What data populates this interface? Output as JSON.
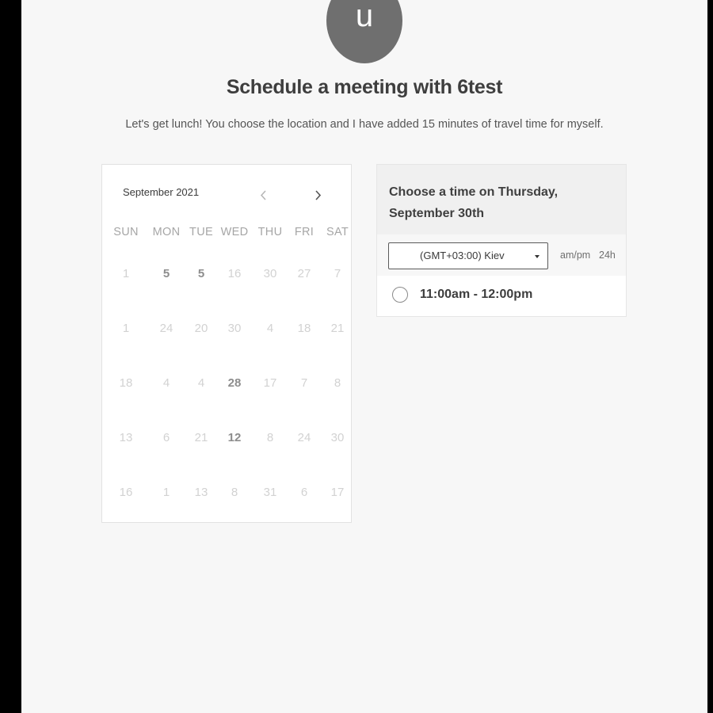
{
  "avatar": {
    "initial": "u"
  },
  "header": {
    "title": "Schedule a meeting with 6test",
    "subtitle": "Let's get lunch! You choose the location and I have added 15 minutes of travel time for myself."
  },
  "calendar": {
    "month_label": "September 2021",
    "prev_icon": "chevron-left-icon",
    "next_icon": "chevron-right-icon",
    "weekdays": [
      "SUN",
      "MON",
      "TUE",
      "WED",
      "THU",
      "FRI",
      "SAT"
    ],
    "weeks": [
      [
        {
          "d": "1",
          "available": false
        },
        {
          "d": "5",
          "available": true
        },
        {
          "d": "5",
          "available": true
        },
        {
          "d": "16",
          "available": false
        },
        {
          "d": "30",
          "available": false
        },
        {
          "d": "27",
          "available": false
        },
        {
          "d": "7",
          "available": false
        }
      ],
      [
        {
          "d": "1",
          "available": false
        },
        {
          "d": "24",
          "available": false
        },
        {
          "d": "20",
          "available": false
        },
        {
          "d": "30",
          "available": false
        },
        {
          "d": "4",
          "available": false
        },
        {
          "d": "18",
          "available": false
        },
        {
          "d": "21",
          "available": false
        }
      ],
      [
        {
          "d": "18",
          "available": false
        },
        {
          "d": "4",
          "available": false
        },
        {
          "d": "4",
          "available": false
        },
        {
          "d": "28",
          "available": true
        },
        {
          "d": "17",
          "available": false
        },
        {
          "d": "7",
          "available": false
        },
        {
          "d": "8",
          "available": false
        }
      ],
      [
        {
          "d": "13",
          "available": false
        },
        {
          "d": "6",
          "available": false
        },
        {
          "d": "21",
          "available": false
        },
        {
          "d": "12",
          "available": true
        },
        {
          "d": "8",
          "available": false
        },
        {
          "d": "24",
          "available": false
        },
        {
          "d": "30",
          "available": false
        }
      ],
      [
        {
          "d": "16",
          "available": false
        },
        {
          "d": "1",
          "available": false
        },
        {
          "d": "13",
          "available": false
        },
        {
          "d": "8",
          "available": false
        },
        {
          "d": "31",
          "available": false
        },
        {
          "d": "6",
          "available": false
        },
        {
          "d": "17",
          "available": false
        }
      ]
    ]
  },
  "times_panel": {
    "heading": "Choose a time on Thursday, September 30th",
    "timezone": "(GMT+03:00) Kiev",
    "format_ampm": "am/pm",
    "format_24h": "24h",
    "slots": [
      {
        "label": "11:00am - 12:00pm"
      }
    ]
  }
}
